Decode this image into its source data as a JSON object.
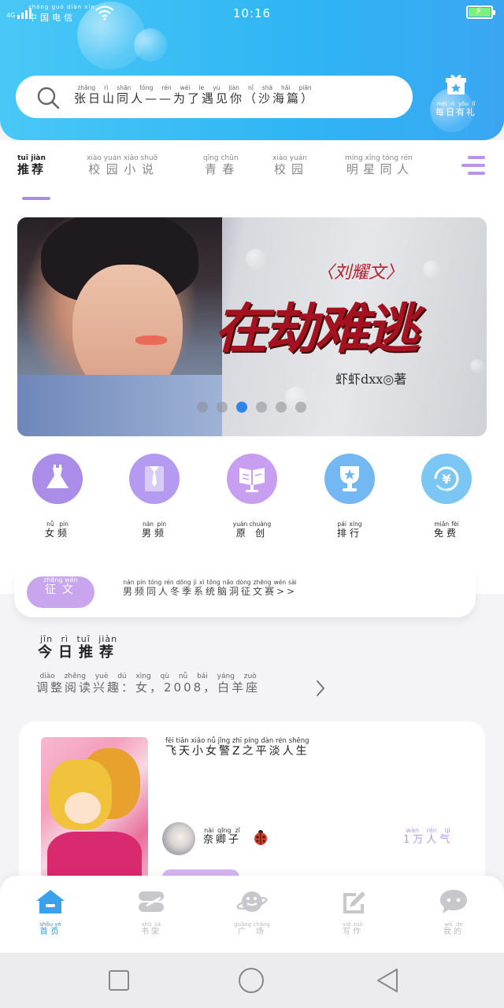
{
  "status_bar": {
    "signal": "4G",
    "carrier_pinyin": "zhōng guó diàn xìn",
    "carrier": "中国电信",
    "time": "10:16"
  },
  "search": {
    "pinyin": "zhāng rì shān tóng rén  wéi le yù jiàn nǐ  shā hǎi piān",
    "text": "张日山同人——为了遇见你（沙海篇）"
  },
  "daily_gift": {
    "pinyin": "měi rì yǒu lǐ",
    "label": "每日有礼"
  },
  "category_tabs": [
    {
      "pinyin": "tuī jiàn",
      "label": "推荐",
      "active": true
    },
    {
      "pinyin": "xiào yuán xiǎo shuō",
      "label": "校园小说",
      "active": false
    },
    {
      "pinyin": "qīng chūn",
      "label": "青春",
      "active": false
    },
    {
      "pinyin": "xiào yuán",
      "label": "校园",
      "active": false
    },
    {
      "pinyin": "míng xīng tóng rén",
      "label": "明星同人",
      "active": false
    }
  ],
  "banner": {
    "author_tag": "〈刘耀文〉",
    "title": "在劫难逃",
    "byline": "虾虾dxx◎著",
    "slides": 6,
    "active_slide": 3
  },
  "quick_links": [
    {
      "pinyin": "nǚ pín",
      "label": "女频",
      "icon": "dress-icon",
      "color": "#a98de9"
    },
    {
      "pinyin": "nán pín",
      "label": "男频",
      "icon": "shirt-icon",
      "color": "#b49af0"
    },
    {
      "pinyin": "yuán chuàng",
      "label": "原创",
      "icon": "book-stand-icon",
      "color": "#c89ef0"
    },
    {
      "pinyin": "pái xíng",
      "label": "排行",
      "icon": "trophy-icon",
      "color": "#73b8f3"
    },
    {
      "pinyin": "miǎn fèi",
      "label": "免费",
      "icon": "yuan-coin-icon",
      "color": "#7cc6f6"
    }
  ],
  "notice": {
    "pill_pinyin": "zhēng wén",
    "pill": "征文",
    "text_pinyin": "nán pín tóng rén dōng jì xì tǒng nǎo dòng zhēng wén sài",
    "text": "男频同人冬季系统脑洞征文赛>>"
  },
  "today": {
    "title_pinyin": "jīn rì tuī jiàn",
    "title": "今日推荐",
    "subtitle_pinyin": "diào zhěng yuè dú xìng qù  nǚ  bái yáng zuò",
    "subtitle": "调整阅读兴趣：女，2008，白羊座"
  },
  "book": {
    "title_pinyin": "fēi tiān xiǎo nǚ jǐng  zhī píng dàn rén shēng",
    "title": "飞天小女警Z之平淡人生",
    "author_pinyin": "nài qīng zǐ",
    "author": "奈卿子",
    "popularity_pinyin": "wàn rén qì",
    "popularity": "1万人气"
  },
  "bottom_tabs": [
    {
      "pinyin": "shǒu yè",
      "label": "首页",
      "icon": "home-icon",
      "active": true
    },
    {
      "pinyin": "shū jià",
      "label": "书架",
      "icon": "bookshelf-icon",
      "active": false
    },
    {
      "pinyin": "guǎng chǎng",
      "label": "广场",
      "icon": "planet-icon",
      "active": false
    },
    {
      "pinyin": "xiě zuò",
      "label": "写作",
      "icon": "pen-icon",
      "active": false
    },
    {
      "pinyin": "wǒ de",
      "label": "我的",
      "icon": "chat-bubble-icon",
      "active": false
    }
  ],
  "colors": {
    "header": "#3ab6f4",
    "accent_purple": "#a98ce4",
    "active_blue": "#2f9be8"
  }
}
